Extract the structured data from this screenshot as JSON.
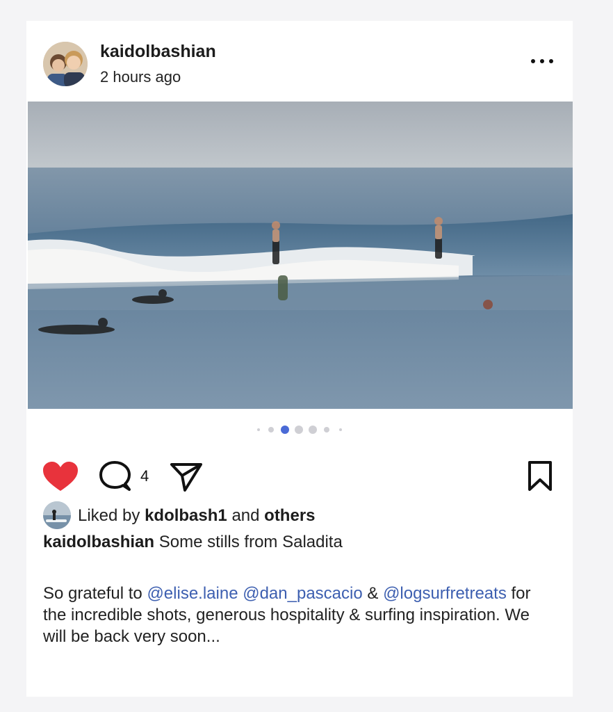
{
  "post": {
    "username": "kaidolbashian",
    "time_ago": "2 hours ago",
    "more_icon": "more-horizontal-icon",
    "carousel": {
      "total": 7,
      "active_index": 2
    },
    "comment_count": "4",
    "liked": true,
    "colors": {
      "like": "#e8333c",
      "mention": "#3d5fb0",
      "active_dot": "#4a6ad6"
    },
    "likes": {
      "prefix": "Liked by",
      "user": "kdolbash1",
      "joiner": "and",
      "others": "others"
    },
    "caption": {
      "author": "kaidolbashian",
      "text": "Some stills from Saladita"
    },
    "body": {
      "t1": "So grateful to",
      "m1": "@elise.laine",
      "m2": "@dan_pascacio",
      "t2": "&",
      "m3": "@logsurfretreats",
      "t3": "for the incredible shots, generous hospitality & surfing inspiration. We will be back very soon..."
    }
  }
}
